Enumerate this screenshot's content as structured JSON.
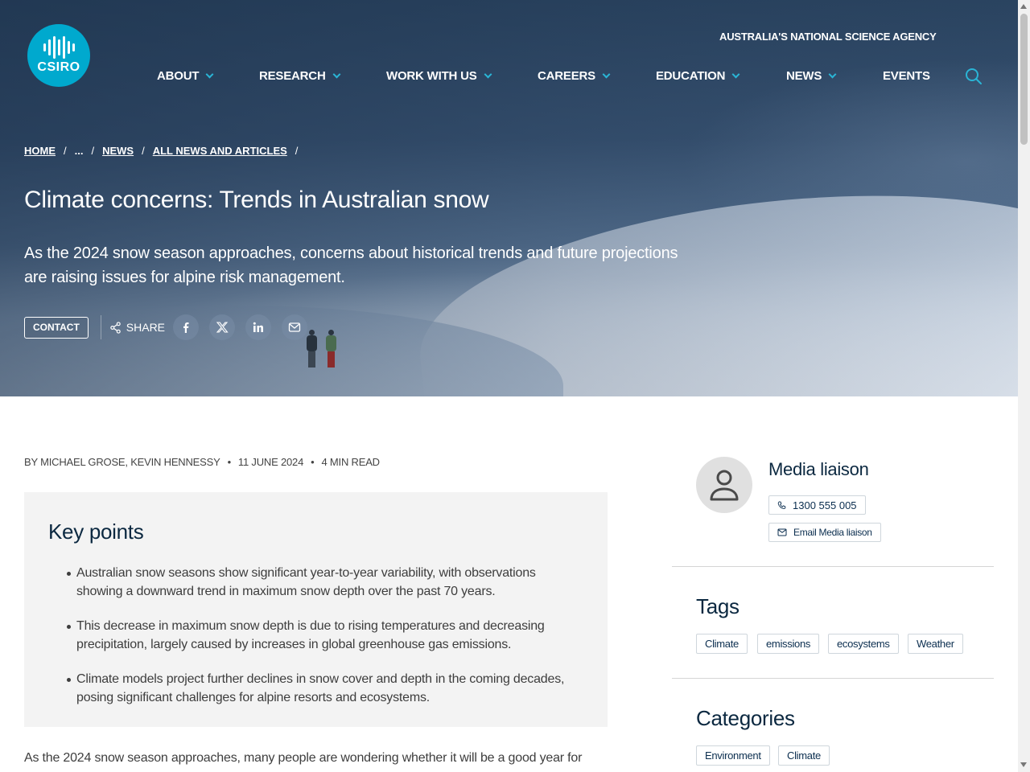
{
  "header": {
    "logo_text": "CSIRO",
    "agency_tagline": "AUSTRALIA'S NATIONAL SCIENCE AGENCY",
    "nav": [
      {
        "label": "ABOUT"
      },
      {
        "label": "RESEARCH"
      },
      {
        "label": "WORK WITH US"
      },
      {
        "label": "CAREERS"
      },
      {
        "label": "EDUCATION"
      },
      {
        "label": "NEWS"
      },
      {
        "label": "EVENTS"
      }
    ]
  },
  "breadcrumb": [
    "HOME",
    "...",
    "NEWS",
    "ALL NEWS AND ARTICLES"
  ],
  "article": {
    "title": "Climate concerns: Trends in Australian snow",
    "lede": "As the 2024 snow season approaches, concerns about historical trends and future projections are raising issues for alpine risk management.",
    "contact_label": "CONTACT",
    "share_label": "SHARE",
    "byline": "BY MICHAEL GROSE, KEVIN HENNESSY",
    "date": "11 JUNE 2024",
    "read_time": "4 MIN READ",
    "key_points_title": "Key points",
    "key_points": [
      "Australian snow seasons show significant year-to-year variability, with observations showing a downward trend in maximum snow depth over the past 70 years.",
      "This decrease in maximum snow depth is due to rising temperatures and decreasing precipitation, largely caused by increases in global greenhouse gas emissions.",
      "Climate models project further declines in snow cover and depth in the coming decades, posing significant challenges for alpine resorts and ecosystems."
    ],
    "body_start": "As the 2024 snow season approaches, many people are wondering whether it will be a good year for"
  },
  "sidebar": {
    "media_title": "Media liaison",
    "phone": "1300 555 005",
    "email_label": "Email Media liaison",
    "tags_title": "Tags",
    "tags": [
      "Climate",
      "emissions",
      "ecosystems",
      "Weather"
    ],
    "categories_title": "Categories",
    "categories": [
      "Environment",
      "Climate"
    ]
  },
  "colors": {
    "brand": "#00a9ce",
    "heading": "#0b2840",
    "keypoints_bg": "#f3f3f3"
  }
}
